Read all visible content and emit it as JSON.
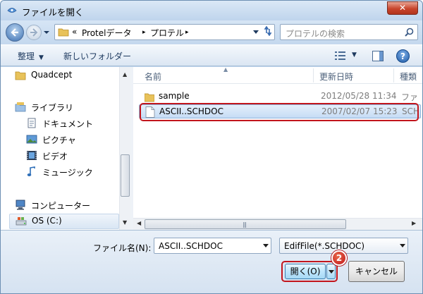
{
  "window": {
    "title": "ファイルを開く",
    "close_label": "✕"
  },
  "address": {
    "overflow": "«",
    "crumbs": [
      "Protelデータ",
      "プロテル"
    ],
    "separator": "▸"
  },
  "search": {
    "placeholder": "プロテルの検索"
  },
  "toolbar": {
    "organize_label": "整理",
    "new_folder_label": "新しいフォルダー"
  },
  "nav": {
    "items": [
      {
        "label": "Quadcept",
        "icon": "folder-icon"
      },
      {
        "label": "ライブラリ",
        "icon": "library-icon"
      },
      {
        "label": "ドキュメント",
        "icon": "documents-icon"
      },
      {
        "label": "ピクチャ",
        "icon": "pictures-icon"
      },
      {
        "label": "ビデオ",
        "icon": "video-icon"
      },
      {
        "label": "ミュージック",
        "icon": "music-icon"
      },
      {
        "label": "コンピューター",
        "icon": "computer-icon"
      },
      {
        "label": "OS (C:)",
        "icon": "drive-icon"
      }
    ]
  },
  "filelist": {
    "columns": [
      "名前",
      "更新日時",
      "種類"
    ],
    "rows": [
      {
        "name": "sample",
        "date": "2012/05/28 11:34",
        "type": "ファ",
        "kind": "folder"
      },
      {
        "name": "ASCII..SCHDOC",
        "date": "2007/02/07 15:23",
        "type": "SCH",
        "kind": "file",
        "selected": true
      }
    ]
  },
  "bottom": {
    "filename_label": "ファイル名(N):",
    "filename_value": "ASCII..SCHDOC",
    "filter_value": "EdifFile(*.SCHDOC)",
    "open_label": "開く(O)",
    "cancel_label": "キャンセル",
    "step_badge": "2"
  },
  "colors": {
    "annotation_red": "#c2161d",
    "selection_blue": "#c6dcf5",
    "window_frame": "#bcd3ec"
  }
}
